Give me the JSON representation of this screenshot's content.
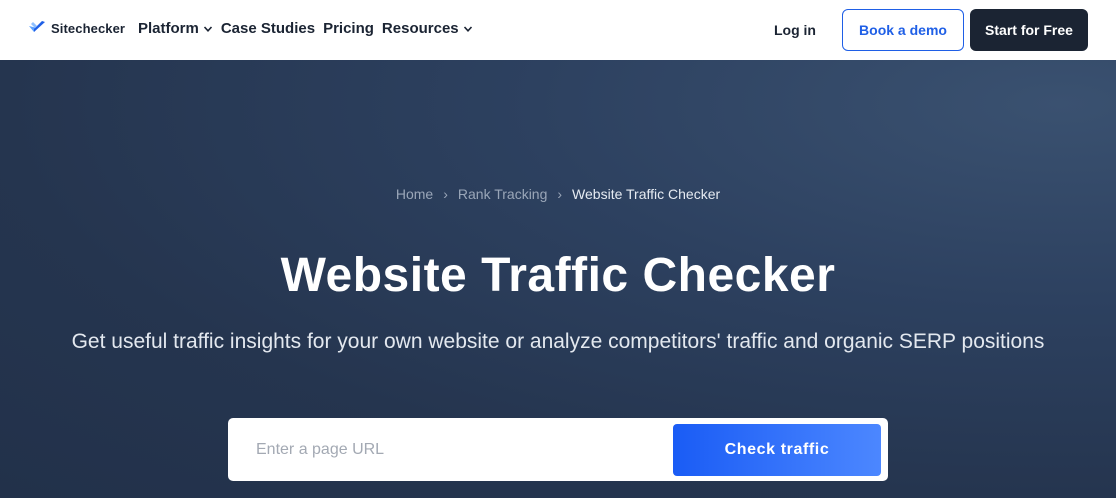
{
  "header": {
    "logo_text": "Sitechecker",
    "nav": [
      {
        "label": "Platform",
        "has_dropdown": true
      },
      {
        "label": "Case Studies",
        "has_dropdown": false
      },
      {
        "label": "Pricing",
        "has_dropdown": false
      },
      {
        "label": "Resources",
        "has_dropdown": true
      }
    ],
    "login_label": "Log in",
    "demo_label": "Book a demo",
    "start_label": "Start for Free"
  },
  "hero": {
    "breadcrumb": [
      "Home",
      "Rank Tracking",
      "Website Traffic Checker"
    ],
    "title": "Website Traffic Checker",
    "subtitle": "Get useful traffic insights for your own website or analyze competitors' traffic and organic SERP positions",
    "search": {
      "placeholder": "Enter a page URL",
      "value": "",
      "button_label": "Check traffic"
    }
  },
  "colors": {
    "brand_blue": "#1f5fe6",
    "dark": "#1b2433",
    "hero_bg": "#2d4160"
  },
  "icons": [
    "sitechecker-logo-icon",
    "chevron-down-icon",
    "chevron-right-icon"
  ]
}
